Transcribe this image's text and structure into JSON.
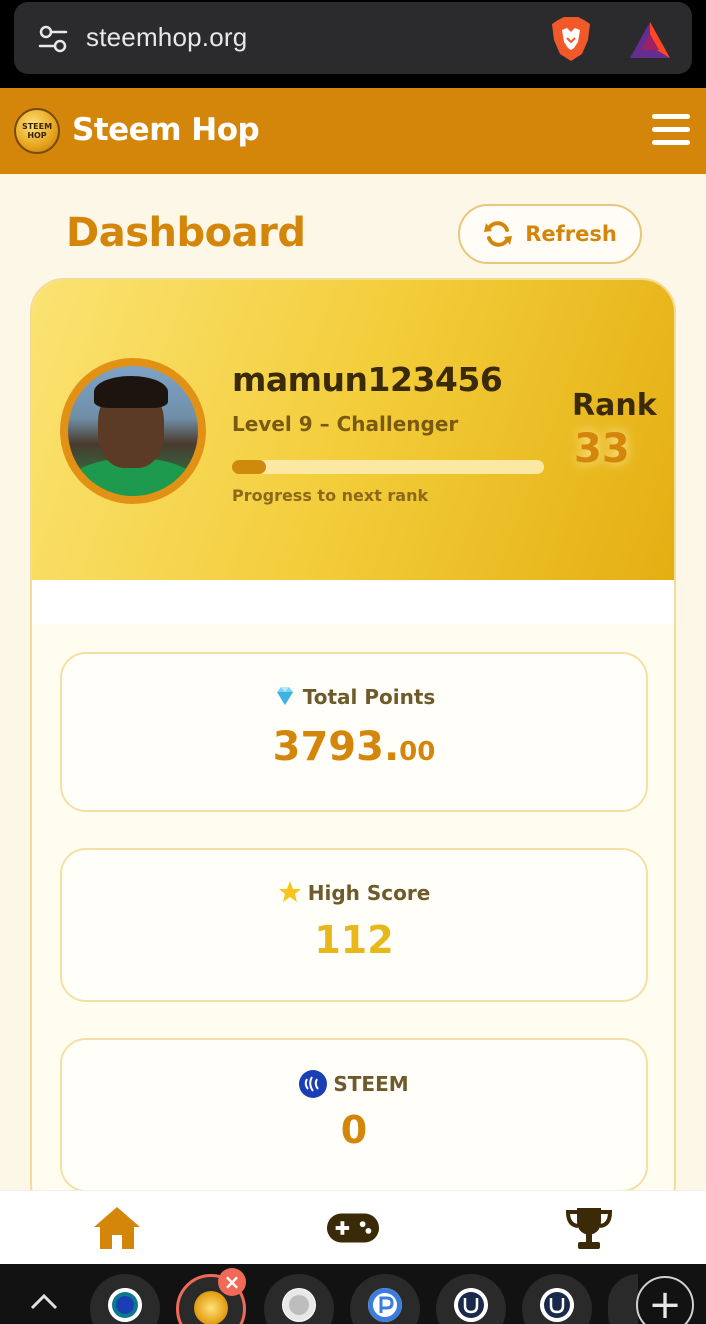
{
  "browser": {
    "url": "steemhop.org",
    "icons": [
      "site-settings-icon",
      "brave-lion-icon",
      "bat-rewards-icon"
    ]
  },
  "app": {
    "brand": "Steem Hop",
    "logo_text": "STEEM HOP",
    "accent_color": "#d4860a"
  },
  "dashboard": {
    "title": "Dashboard",
    "refresh_label": "Refresh"
  },
  "profile": {
    "username": "mamun123456",
    "level": "Level 9 – Challenger",
    "progress_label": "Progress to next rank",
    "progress_fraction": 0.11,
    "rank_label": "Rank",
    "rank_value": "33"
  },
  "stats": {
    "points": {
      "icon": "gem-icon",
      "label": "Total Points",
      "value_int": "3793.",
      "value_dec": "00"
    },
    "high_score": {
      "icon": "star-icon",
      "label": "High Score",
      "value": "112"
    },
    "steem": {
      "icon": "steem-icon",
      "label": "STEEM",
      "value": "0"
    }
  },
  "bottom_nav": [
    "home-icon",
    "gamepad-icon",
    "trophy-icon"
  ],
  "tabs": {
    "count_visible": 7,
    "new_tab_glyph": "+"
  }
}
